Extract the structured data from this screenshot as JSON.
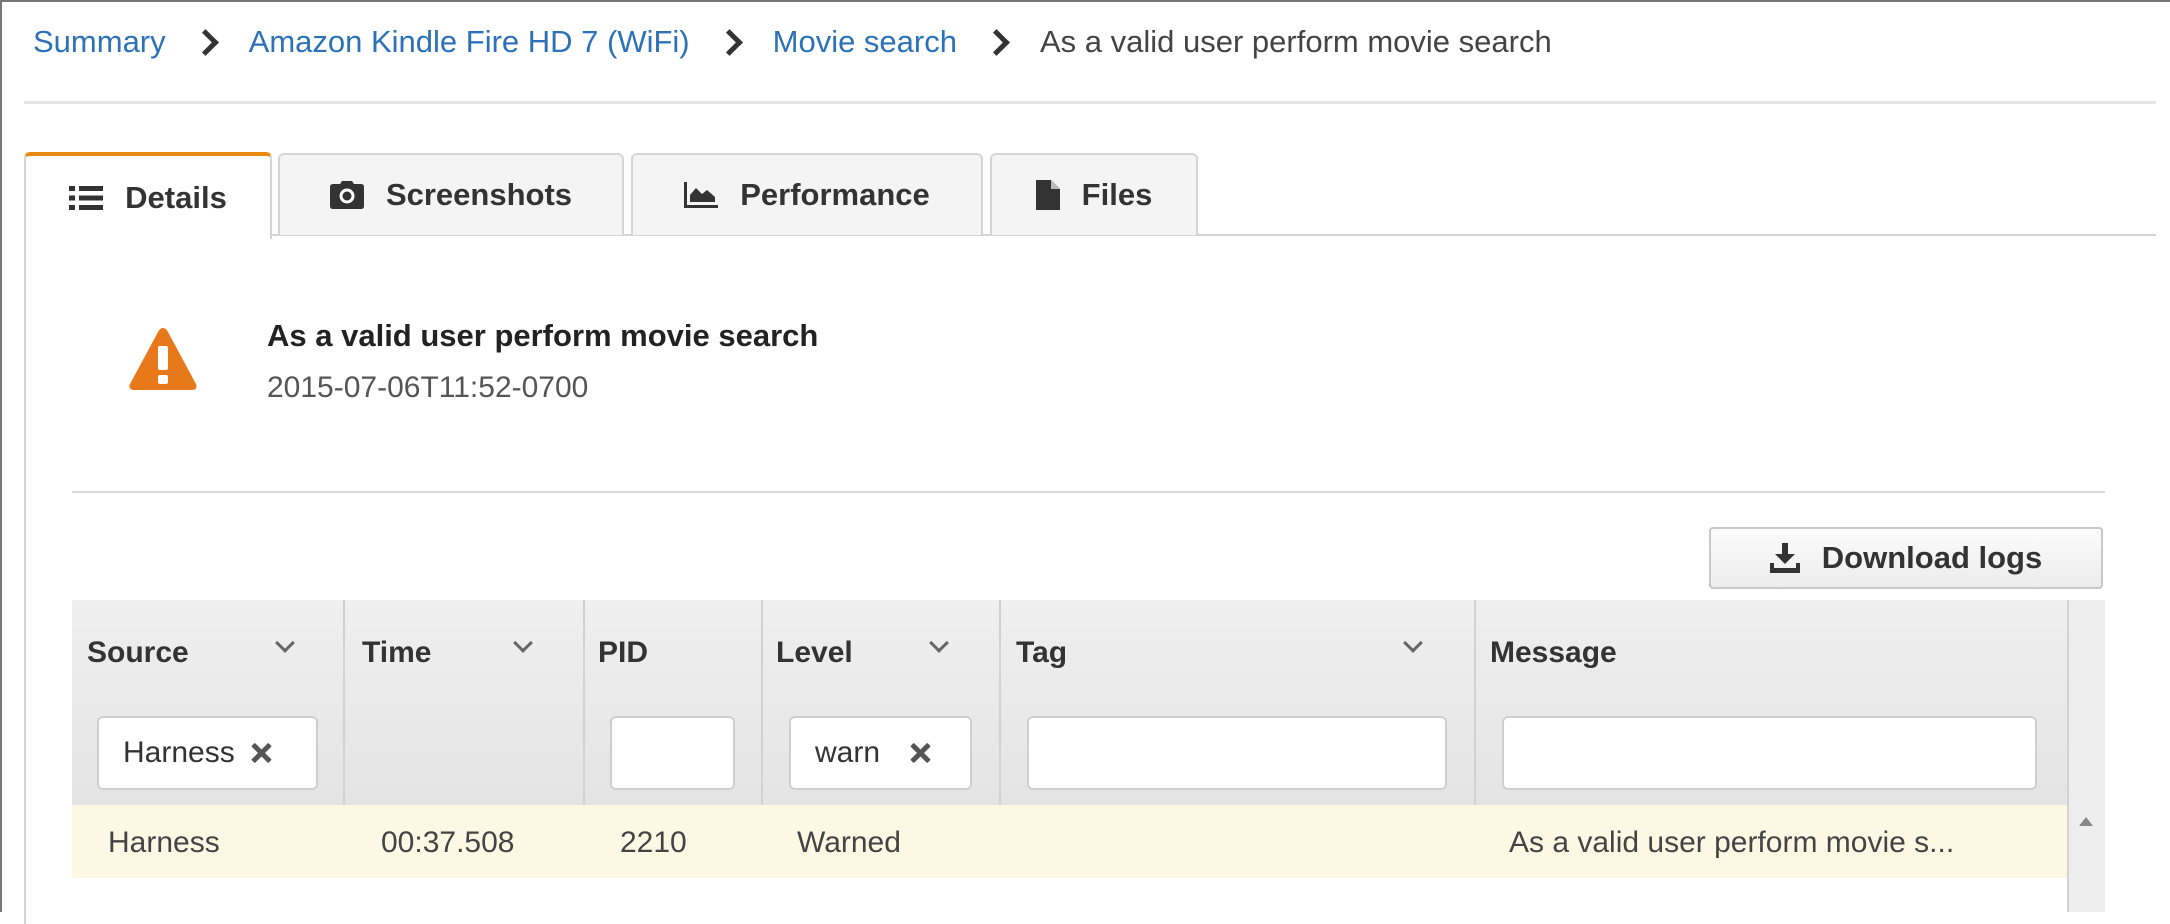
{
  "breadcrumb": {
    "items": [
      "Summary",
      "Amazon Kindle Fire HD 7 (WiFi)",
      "Movie search"
    ],
    "current": "As a valid user perform movie search"
  },
  "tabs": [
    {
      "label": "Details",
      "icon": "list-icon",
      "active": true
    },
    {
      "label": "Screenshots",
      "icon": "camera-icon",
      "active": false
    },
    {
      "label": "Performance",
      "icon": "area-chart-icon",
      "active": false
    },
    {
      "label": "Files",
      "icon": "file-icon",
      "active": false
    }
  ],
  "test": {
    "status_icon": "warning-icon",
    "title": "As a valid user perform movie search",
    "timestamp": "2015-07-06T11:52-0700"
  },
  "download_button": {
    "label": "Download logs",
    "icon": "download-icon"
  },
  "log_table": {
    "columns": [
      "Source",
      "Time",
      "PID",
      "Level",
      "Tag",
      "Message"
    ],
    "filters": {
      "source": "Harness",
      "pid": "",
      "level": "warn",
      "tag": "",
      "message": ""
    },
    "rows": [
      {
        "source": "Harness",
        "time": "00:37.508",
        "pid": "2210",
        "level": "Warned",
        "tag": "",
        "message": "As a valid user perform movie s..."
      }
    ]
  },
  "colors": {
    "accent_tab": "#e88a14",
    "warning": "#e8791a",
    "link": "#2d72b8",
    "row_highlight": "#fdf8e4"
  }
}
